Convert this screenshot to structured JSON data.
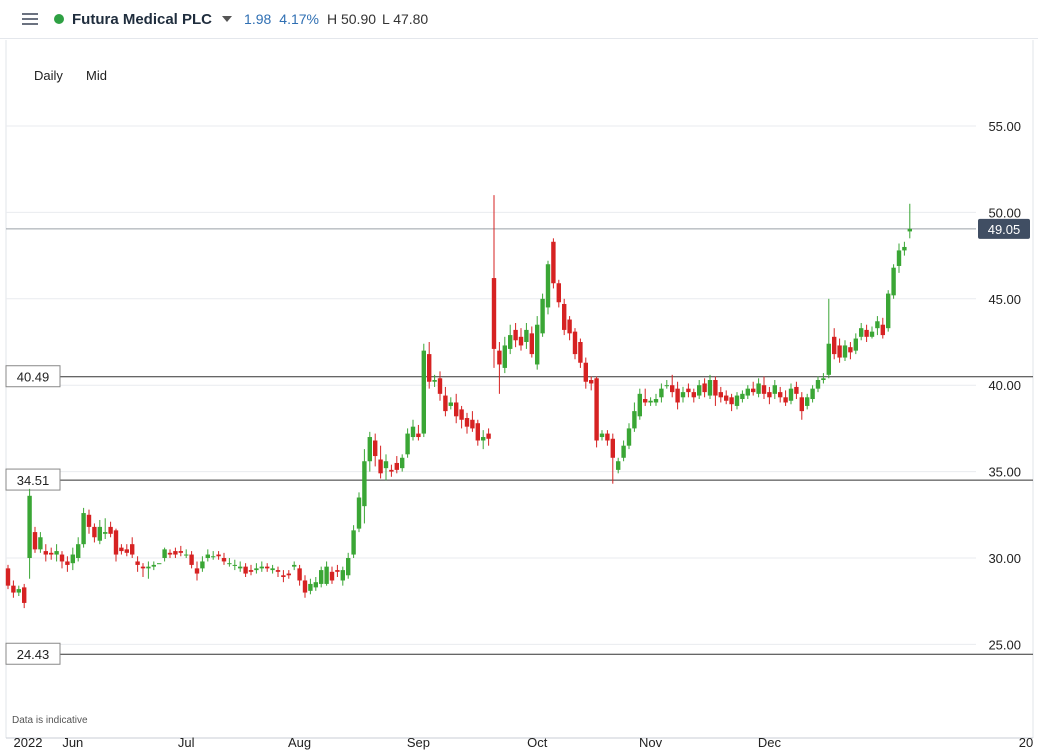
{
  "header": {
    "instrument": "Futura Medical PLC",
    "change_abs": "1.98",
    "change_pct": "4.17%",
    "high": "H 50.90",
    "low": "L 47.80"
  },
  "toolbar": {
    "timeframe": "Daily",
    "price_type": "Mid"
  },
  "footnote": "Data is indicative",
  "colors": {
    "up": "#3aa635",
    "down": "#d62222",
    "status": "#2ea043",
    "change": "#2f6fb3",
    "last_label_bg": "#404e63"
  },
  "chart_data": {
    "type": "candlestick",
    "ylim": [
      22.5,
      57
    ],
    "yticks": [
      55,
      50,
      45,
      40,
      35,
      30,
      25
    ],
    "ytick_labels": [
      "55.00",
      "50.00",
      "45.00",
      "40.00",
      "35.00",
      "30.00",
      "25.00"
    ],
    "xticks": [
      {
        "label": "2022",
        "index": 0
      },
      {
        "label": "Jun",
        "index": 12
      },
      {
        "label": "Jul",
        "index": 33
      },
      {
        "label": "Aug",
        "index": 54
      },
      {
        "label": "Sep",
        "index": 76
      },
      {
        "label": "Oct",
        "index": 98
      },
      {
        "label": "Nov",
        "index": 119
      },
      {
        "label": "Dec",
        "index": 141
      },
      {
        "label": "20",
        "index": 166
      }
    ],
    "horizontal_lines": [
      {
        "label": "40.49",
        "value": 40.49
      },
      {
        "label": "34.51",
        "value": 34.51
      },
      {
        "label": "24.43",
        "value": 24.43
      }
    ],
    "last_price": {
      "label": "49.05",
      "value": 49.05
    },
    "candles": [
      [
        29.4,
        28.4,
        29.6,
        28.2
      ],
      [
        28.4,
        28.0,
        28.7,
        27.7
      ],
      [
        28.0,
        28.2,
        28.4,
        27.8
      ],
      [
        28.3,
        27.4,
        28.5,
        27.1
      ],
      [
        30.0,
        33.6,
        34.0,
        28.8
      ],
      [
        31.5,
        30.5,
        31.8,
        30.3
      ],
      [
        30.5,
        31.2,
        31.5,
        30.3
      ],
      [
        30.4,
        30.2,
        30.8,
        29.8
      ],
      [
        30.3,
        30.2,
        30.6,
        29.9
      ],
      [
        30.2,
        30.4,
        30.8,
        29.8
      ],
      [
        30.2,
        29.8,
        30.4,
        29.4
      ],
      [
        29.8,
        29.6,
        30.1,
        29.2
      ],
      [
        29.7,
        30.2,
        30.6,
        29.3
      ],
      [
        30.0,
        30.8,
        31.2,
        29.8
      ],
      [
        30.8,
        32.6,
        32.9,
        30.6
      ],
      [
        32.5,
        31.8,
        32.8,
        31.4
      ],
      [
        31.8,
        31.2,
        32.0,
        30.9
      ],
      [
        31.0,
        31.8,
        32.2,
        30.8
      ],
      [
        31.4,
        31.5,
        32.3,
        31.1
      ],
      [
        31.8,
        31.4,
        32.1,
        31.2
      ],
      [
        31.6,
        30.2,
        31.7,
        29.8
      ],
      [
        30.6,
        30.4,
        30.8,
        30.2
      ],
      [
        30.5,
        30.3,
        30.8,
        30.1
      ],
      [
        30.8,
        30.2,
        31.2,
        30.0
      ],
      [
        29.8,
        29.6,
        30.1,
        29.2
      ],
      [
        29.5,
        29.4,
        29.7,
        28.9
      ],
      [
        29.4,
        29.5,
        29.8,
        28.8
      ],
      [
        29.5,
        29.6,
        29.8,
        29.3
      ],
      [
        29.7,
        29.7,
        29.7,
        29.7
      ],
      [
        30.0,
        30.5,
        30.6,
        29.8
      ],
      [
        30.3,
        30.2,
        30.5,
        30.0
      ],
      [
        30.4,
        30.2,
        30.6,
        30.0
      ],
      [
        30.4,
        30.3,
        30.7,
        30.1
      ],
      [
        30.2,
        30.2,
        30.5,
        30.0
      ],
      [
        30.2,
        29.6,
        30.4,
        29.4
      ],
      [
        29.4,
        29.1,
        29.8,
        28.7
      ],
      [
        29.4,
        29.8,
        30.1,
        29.2
      ],
      [
        30.0,
        30.2,
        30.5,
        29.8
      ],
      [
        30.1,
        30.1,
        30.4,
        29.9
      ],
      [
        30.2,
        30.1,
        30.4,
        29.9
      ],
      [
        30.0,
        29.8,
        30.3,
        29.6
      ],
      [
        29.7,
        29.7,
        30.0,
        29.5
      ],
      [
        29.6,
        29.6,
        29.9,
        29.3
      ],
      [
        29.4,
        29.5,
        29.8,
        29.2
      ],
      [
        29.5,
        29.1,
        29.7,
        28.9
      ],
      [
        29.3,
        29.2,
        29.6,
        29.0
      ],
      [
        29.3,
        29.4,
        29.7,
        29.1
      ],
      [
        29.4,
        29.5,
        29.8,
        29.2
      ],
      [
        29.5,
        29.4,
        29.7,
        29.2
      ],
      [
        29.3,
        29.4,
        29.6,
        29.1
      ],
      [
        29.3,
        29.2,
        29.5,
        28.9
      ],
      [
        29.0,
        28.9,
        29.3,
        28.6
      ],
      [
        29.1,
        29.0,
        29.3,
        28.8
      ],
      [
        29.5,
        29.6,
        29.8,
        29.3
      ],
      [
        29.4,
        28.7,
        29.6,
        28.4
      ],
      [
        28.7,
        28.0,
        29.0,
        27.7
      ],
      [
        28.1,
        28.5,
        28.8,
        27.9
      ],
      [
        28.3,
        28.6,
        28.9,
        28.1
      ],
      [
        28.5,
        29.3,
        29.5,
        28.3
      ],
      [
        28.5,
        29.5,
        29.8,
        28.4
      ],
      [
        29.2,
        28.7,
        29.5,
        28.5
      ],
      [
        29.3,
        29.2,
        29.6,
        28.9
      ],
      [
        28.7,
        29.3,
        29.5,
        28.4
      ],
      [
        29.0,
        30.0,
        30.3,
        28.8
      ],
      [
        30.2,
        31.6,
        31.9,
        30.0
      ],
      [
        31.7,
        33.5,
        33.8,
        31.5
      ],
      [
        33.0,
        35.6,
        36.3,
        32.0
      ],
      [
        35.6,
        37.0,
        37.3,
        35.0
      ],
      [
        36.8,
        35.9,
        37.2,
        35.3
      ],
      [
        35.7,
        34.9,
        36.5,
        34.6
      ],
      [
        35.2,
        35.6,
        36.0,
        34.5
      ],
      [
        35.1,
        35.0,
        35.4,
        34.7
      ],
      [
        35.5,
        35.1,
        35.9,
        34.9
      ],
      [
        35.2,
        35.8,
        36.0,
        35.0
      ],
      [
        36.0,
        37.2,
        37.5,
        35.8
      ],
      [
        37.0,
        37.6,
        38.0,
        36.8
      ],
      [
        37.2,
        37.0,
        37.7,
        36.8
      ],
      [
        37.2,
        42.0,
        42.4,
        37.0
      ],
      [
        41.8,
        40.2,
        42.5,
        39.8
      ],
      [
        40.2,
        40.3,
        40.6,
        39.9
      ],
      [
        40.4,
        39.5,
        40.8,
        39.1
      ],
      [
        39.4,
        38.5,
        39.9,
        38.2
      ],
      [
        38.8,
        39.0,
        39.3,
        38.6
      ],
      [
        39.0,
        38.2,
        39.5,
        37.8
      ],
      [
        38.6,
        38.0,
        38.8,
        37.5
      ],
      [
        38.1,
        37.6,
        38.4,
        37.2
      ],
      [
        38.0,
        37.5,
        38.5,
        37.3
      ],
      [
        37.8,
        36.8,
        38.0,
        36.5
      ],
      [
        36.8,
        37.0,
        37.4,
        36.3
      ],
      [
        37.2,
        36.9,
        37.5,
        36.5
      ],
      [
        46.2,
        42.1,
        51.0,
        41.0
      ],
      [
        42.0,
        41.2,
        42.5,
        39.5
      ],
      [
        41.0,
        42.3,
        42.8,
        40.7
      ],
      [
        42.1,
        42.9,
        43.5,
        41.8
      ],
      [
        43.2,
        42.6,
        43.6,
        42.2
      ],
      [
        42.8,
        42.3,
        43.3,
        42.0
      ],
      [
        42.5,
        43.2,
        43.6,
        42.1
      ],
      [
        43.0,
        41.8,
        43.4,
        41.6
      ],
      [
        41.2,
        43.5,
        44.0,
        40.9
      ],
      [
        43.0,
        45.0,
        45.3,
        42.8
      ],
      [
        44.5,
        47.0,
        47.2,
        44.1
      ],
      [
        48.3,
        45.9,
        48.5,
        45.6
      ],
      [
        45.9,
        44.8,
        46.1,
        44.5
      ],
      [
        44.7,
        43.2,
        45.0,
        42.9
      ],
      [
        43.8,
        43.0,
        44.0,
        42.6
      ],
      [
        43.1,
        41.8,
        43.3,
        41.5
      ],
      [
        42.5,
        41.3,
        42.7,
        41.0
      ],
      [
        41.3,
        40.2,
        41.6,
        39.8
      ],
      [
        40.3,
        40.1,
        40.5,
        39.7
      ],
      [
        40.4,
        36.8,
        40.5,
        36.4
      ],
      [
        37.0,
        37.2,
        37.4,
        36.8
      ],
      [
        37.2,
        36.8,
        37.4,
        36.5
      ],
      [
        36.9,
        35.8,
        37.2,
        34.3
      ],
      [
        35.1,
        35.6,
        35.8,
        34.9
      ],
      [
        35.8,
        36.5,
        36.8,
        35.6
      ],
      [
        36.5,
        37.5,
        37.8,
        36.3
      ],
      [
        37.5,
        38.5,
        39.0,
        37.3
      ],
      [
        38.2,
        39.5,
        39.8,
        38.0
      ],
      [
        39.2,
        39.0,
        39.8,
        38.8
      ],
      [
        39.0,
        39.1,
        39.3,
        38.8
      ],
      [
        39.0,
        39.2,
        39.5,
        38.8
      ],
      [
        39.3,
        39.8,
        40.1,
        39.0
      ],
      [
        40.0,
        40.0,
        40.3,
        39.8
      ],
      [
        40.0,
        39.6,
        40.6,
        39.3
      ],
      [
        39.8,
        39.0,
        40.2,
        38.6
      ],
      [
        39.3,
        39.6,
        39.9,
        39.0
      ],
      [
        39.8,
        39.6,
        40.1,
        39.3
      ],
      [
        39.6,
        39.3,
        39.8,
        39.0
      ],
      [
        39.4,
        40.0,
        40.3,
        39.2
      ],
      [
        40.1,
        39.6,
        40.4,
        39.3
      ],
      [
        39.4,
        40.3,
        40.6,
        39.2
      ],
      [
        40.3,
        39.4,
        40.5,
        38.8
      ],
      [
        39.6,
        39.3,
        39.9,
        39.0
      ],
      [
        39.4,
        39.1,
        39.7,
        38.9
      ],
      [
        39.3,
        38.9,
        39.5,
        38.5
      ],
      [
        38.8,
        39.4,
        39.6,
        38.6
      ],
      [
        39.2,
        39.5,
        39.7,
        39.0
      ],
      [
        39.4,
        39.8,
        40.0,
        39.2
      ],
      [
        39.8,
        39.6,
        40.2,
        39.4
      ],
      [
        39.5,
        40.1,
        40.4,
        39.3
      ],
      [
        40.0,
        39.5,
        40.5,
        39.2
      ],
      [
        39.6,
        39.3,
        39.9,
        38.9
      ],
      [
        39.5,
        40.0,
        40.3,
        39.2
      ],
      [
        39.6,
        39.3,
        39.9,
        39.0
      ],
      [
        39.3,
        39.0,
        39.7,
        38.8
      ],
      [
        39.1,
        39.8,
        40.1,
        38.9
      ],
      [
        39.9,
        39.5,
        40.2,
        39.2
      ],
      [
        39.3,
        38.5,
        39.6,
        38.0
      ],
      [
        38.8,
        39.3,
        39.5,
        38.6
      ],
      [
        39.2,
        39.8,
        40.0,
        39.0
      ],
      [
        39.8,
        40.3,
        40.5,
        39.6
      ],
      [
        40.3,
        40.4,
        40.7,
        40.1
      ],
      [
        40.6,
        42.4,
        45.0,
        40.4
      ],
      [
        42.8,
        41.8,
        43.3,
        41.5
      ],
      [
        42.3,
        41.6,
        42.7,
        41.3
      ],
      [
        41.6,
        42.3,
        42.6,
        41.4
      ],
      [
        42.2,
        41.9,
        42.5,
        41.5
      ],
      [
        42.0,
        42.7,
        43.0,
        41.8
      ],
      [
        42.8,
        43.3,
        43.6,
        42.6
      ],
      [
        43.2,
        42.8,
        43.5,
        42.5
      ],
      [
        42.8,
        43.1,
        43.4,
        42.7
      ],
      [
        43.3,
        43.7,
        44.0,
        42.9
      ],
      [
        43.5,
        42.9,
        43.9,
        42.7
      ],
      [
        43.3,
        45.3,
        45.5,
        43.1
      ],
      [
        45.2,
        46.8,
        47.0,
        45.0
      ],
      [
        46.9,
        47.8,
        48.2,
        46.5
      ],
      [
        47.8,
        48.0,
        48.3,
        47.5
      ],
      [
        48.9,
        49.05,
        50.5,
        48.5
      ]
    ]
  }
}
